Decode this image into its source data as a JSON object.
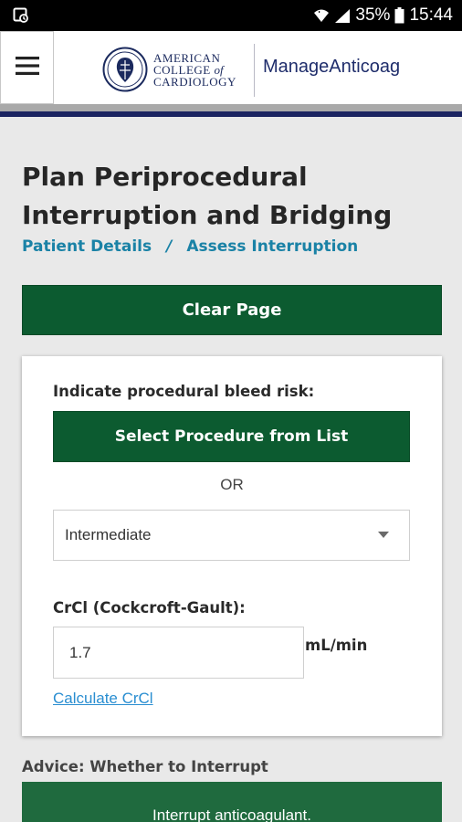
{
  "status_bar": {
    "battery_percent": "35%",
    "time": "15:44",
    "icons": [
      "image-notification-icon",
      "wifi-icon",
      "signal-icon",
      "battery-icon"
    ]
  },
  "header": {
    "menu_icon": "hamburger-menu-icon",
    "logo_lines": [
      "AMERICAN",
      "COLLEGE",
      "of",
      "CARDIOLOGY"
    ],
    "app_name": "ManageAnticoag",
    "colors": {
      "navy": "#1b2461",
      "logo_text": "#1b2a5e"
    }
  },
  "page": {
    "title": "Plan Periprocedural Interruption and Bridging",
    "breadcrumb": {
      "items": [
        "Patient Details",
        "Assess Interruption"
      ],
      "separator": "/"
    },
    "clear_button": "Clear Page"
  },
  "form": {
    "bleed_risk_label": "Indicate procedural bleed risk:",
    "select_procedure_button": "Select Procedure from List",
    "or_text": "OR",
    "bleed_risk_select": {
      "value": "Intermediate"
    },
    "crcl_label": "CrCl (Cockcroft-Gault):",
    "crcl_value": "1.7",
    "crcl_unit": "mL/min",
    "calc_link": "Calculate CrCl"
  },
  "advice": {
    "label": "Advice: Whether to Interrupt",
    "text": "Interrupt anticoagulant."
  },
  "colors": {
    "primary_green": "#0c5b30",
    "link_blue": "#1a82a6",
    "advice_green": "#1f6a3e"
  }
}
